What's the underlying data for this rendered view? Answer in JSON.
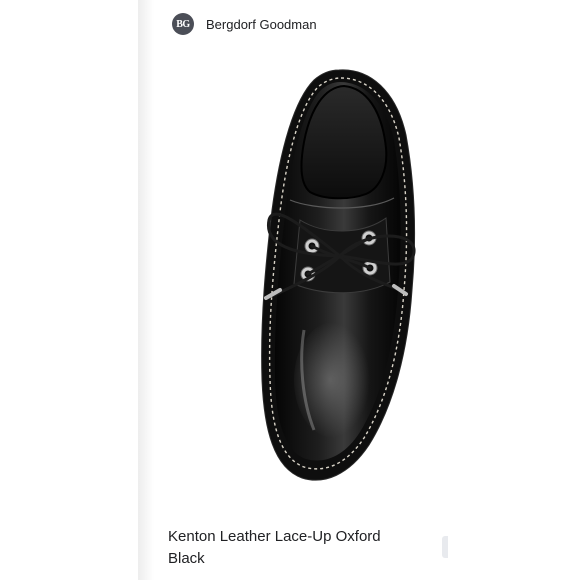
{
  "store": {
    "logo_text": "BG",
    "name": "Bergdorf Goodman"
  },
  "product": {
    "image_icon": "oxford-shoe-image",
    "title_line1": "Kenton Leather Lace-Up Oxford",
    "title_line2": "Black"
  }
}
